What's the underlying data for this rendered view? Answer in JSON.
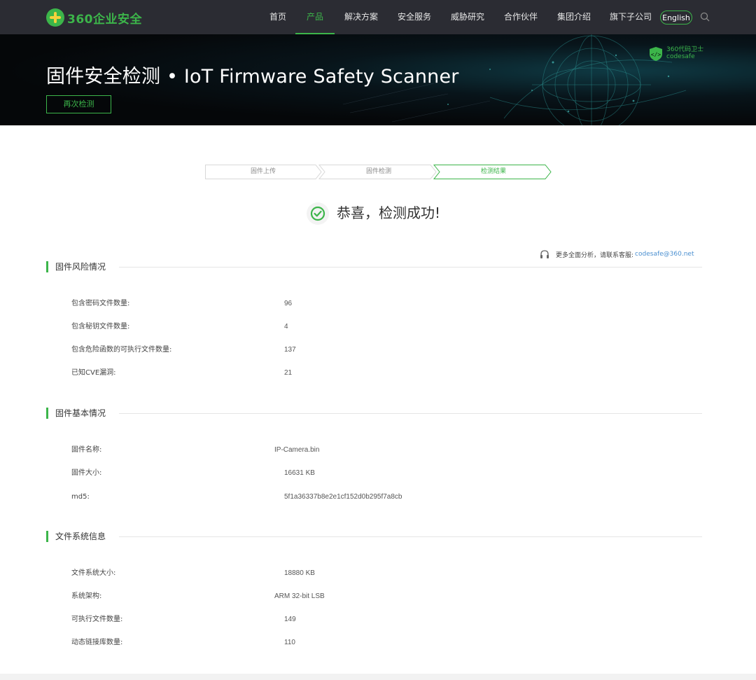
{
  "nav": {
    "logo_text": "360企业安全",
    "items": [
      {
        "label": "首页"
      },
      {
        "label": "产品"
      },
      {
        "label": "解决方案"
      },
      {
        "label": "安全服务"
      },
      {
        "label": "威胁研究"
      },
      {
        "label": "合作伙伴"
      },
      {
        "label": "集团介绍"
      },
      {
        "label": "旗下子公司"
      }
    ],
    "active_index": 1,
    "language_button": "English",
    "search_icon": "search-icon"
  },
  "banner": {
    "title": "固件安全检测 • IoT Firmware Safety Scanner",
    "retest_button": "再次检测",
    "codesafe_line1": "360代码卫士",
    "codesafe_line2": "codesafe"
  },
  "steps": [
    {
      "label": "固件上传",
      "active": false
    },
    {
      "label": "固件检测",
      "active": false
    },
    {
      "label": "检测结果",
      "active": true
    }
  ],
  "result": {
    "message": "恭喜，检测成功!",
    "icon": "check-circle-icon"
  },
  "contact": {
    "text": "更多全面分析，请联系客服:",
    "email": "codesafe@360.net",
    "icon": "headset-icon"
  },
  "sections": [
    {
      "title": "固件风险情况",
      "rows": [
        {
          "label": "包含密码文件数量:",
          "value": "96"
        },
        {
          "label": "包含秘钥文件数量:",
          "value": "4"
        },
        {
          "label": "包含危险函数的可执行文件数量:",
          "value": "137"
        },
        {
          "label": "已知CVE漏洞:",
          "value": "21"
        }
      ]
    },
    {
      "title": "固件基本情况",
      "rows": [
        {
          "label": "固件名称:",
          "value": "IP-Camera.bin"
        },
        {
          "label": "固件大小:",
          "value": "16631 KB"
        },
        {
          "label": "md5:",
          "value": "5f1a36337b8e2e1cf152d0b295f7a8cb"
        }
      ]
    },
    {
      "title": "文件系统信息",
      "rows": [
        {
          "label": "文件系统大小:",
          "value": "18880 KB"
        },
        {
          "label": "系统架构:",
          "value": "ARM 32-bit LSB"
        },
        {
          "label": "可执行文件数量:",
          "value": "149"
        },
        {
          "label": "动态链接库数量:",
          "value": "110"
        }
      ]
    }
  ],
  "colors": {
    "accent": "#3cb54a",
    "nav_bg": "#2b2c33",
    "link": "#4a8fd0"
  }
}
